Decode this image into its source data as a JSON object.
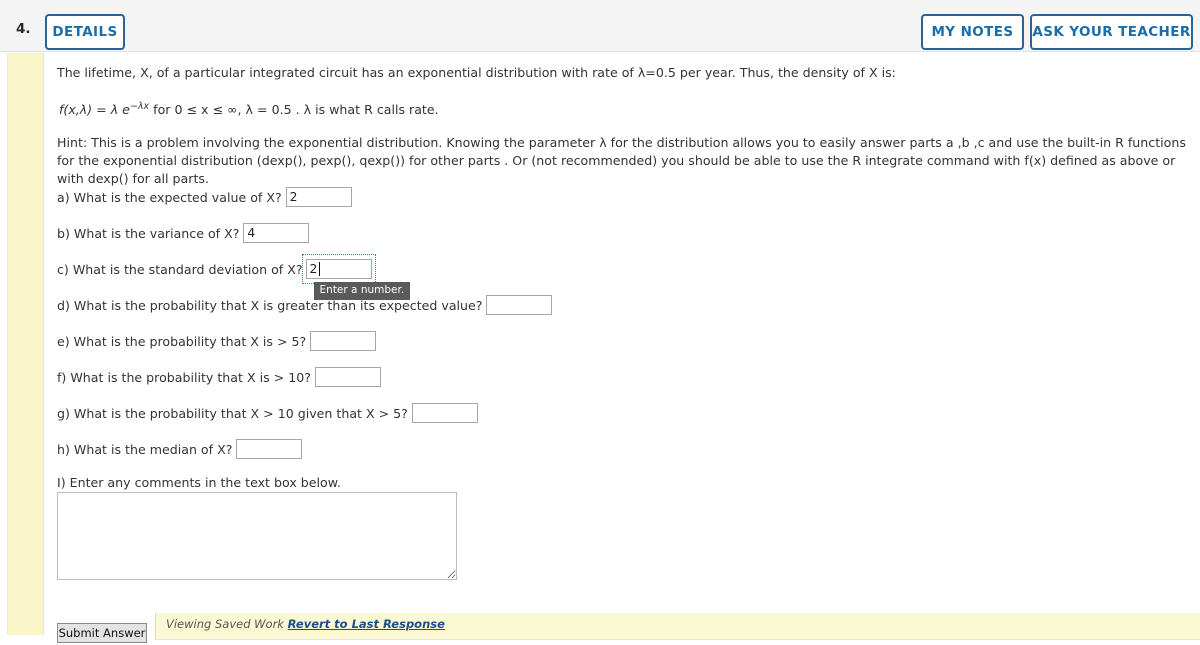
{
  "header": {
    "question_number": "4.",
    "details_label": "DETAILS",
    "my_notes_label": "MY NOTES",
    "ask_teacher_label": "ASK YOUR TEACHER",
    "accent_color": "#2a6496",
    "bar_background": "#f4f4f4"
  },
  "problem": {
    "intro_part1": "The lifetime, X, of a particular integrated circuit has an exponential distribution with rate of ",
    "intro_lambda": "λ=0.5",
    "intro_part2": " per year. Thus, the density of X is:",
    "formula_prefix": "f(x,λ) = λ e",
    "formula_exponent": "−λx",
    "formula_suffix": " for 0 ≤ x ≤ ∞, λ = 0.5 . λ is what R calls rate.",
    "hint": "Hint: This is a problem involving the exponential distribution. Knowing the parameter λ for the distribution allows you to easily answer parts a ,b ,c and use the built-in R functions for the exponential distribution (dexp(), pexp(), qexp()) for other parts . Or (not recommended) you should be able to use the R integrate command with f(x) defined as above or with dexp() for all parts."
  },
  "questions": [
    {
      "id": "a",
      "text": "a) What is the expected value of X?",
      "value": "2",
      "placeholder": "",
      "focused": false
    },
    {
      "id": "b",
      "text": "b) What is the variance of X?",
      "value": "4",
      "placeholder": "",
      "focused": false
    },
    {
      "id": "c",
      "text": "c) What is the standard deviation of X?",
      "value": "2",
      "placeholder": "",
      "focused": true,
      "tooltip": "Enter a number."
    },
    {
      "id": "d",
      "text": "d) What is the probability that X is greater than its expected value?",
      "value": "",
      "placeholder": "",
      "focused": false
    },
    {
      "id": "e",
      "text": "e) What is the probability that X is > 5?",
      "value": "",
      "placeholder": "",
      "focused": false
    },
    {
      "id": "f",
      "text": "f) What is the probability that X is > 10?",
      "value": "",
      "placeholder": "",
      "focused": false
    },
    {
      "id": "g",
      "text": "g) What is the probability that X > 10 given that X > 5?",
      "value": "",
      "placeholder": "",
      "focused": false
    },
    {
      "id": "h",
      "text": "h) What is the median of X?",
      "value": "",
      "placeholder": "",
      "focused": false
    }
  ],
  "comments": {
    "label": "I) Enter any comments in the text box below.",
    "value": "",
    "placeholder": ""
  },
  "footer": {
    "submit_label": "Submit Answer",
    "status_text": "Viewing Saved Work",
    "revert_link": "Revert to Last Response",
    "note_background": "#fbf8d4",
    "link_color": "#1b4e8f"
  }
}
